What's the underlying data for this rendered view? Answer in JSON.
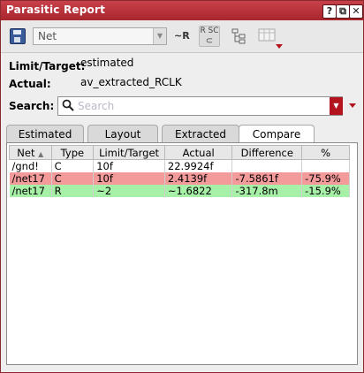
{
  "window": {
    "title": "Parasitic Report",
    "buttons": [
      "?",
      "⧉",
      "✕"
    ]
  },
  "toolbar": {
    "net_select_value": "Net",
    "r_label": "~R",
    "rsc_icon_text": "R SC"
  },
  "info": {
    "limit_label": "Limit/Target:",
    "limit_value": "estimated",
    "actual_label": "Actual:",
    "actual_value": "av_extracted_RCLK"
  },
  "search": {
    "label": "Search:",
    "placeholder": "Search"
  },
  "tabs": [
    {
      "label": "Estimated"
    },
    {
      "label": "Layout"
    },
    {
      "label": "Extracted"
    },
    {
      "label": "Compare"
    }
  ],
  "table": {
    "headers": [
      "Net",
      "Type",
      "Limit/Target",
      "Actual",
      "Difference",
      "%"
    ],
    "rows": [
      {
        "net": "/gnd!",
        "type": "C",
        "limit": "10f",
        "actual": "22.9924f",
        "difference": "",
        "pct": ""
      },
      {
        "net": "/net17",
        "type": "C",
        "limit": "10f",
        "actual": "2.4139f",
        "difference": "-7.5861f",
        "pct": "-75.9%"
      },
      {
        "net": "/net17",
        "type": "R",
        "limit": "~2",
        "actual": "~1.6822",
        "difference": "-317.8m",
        "pct": "-15.9%"
      }
    ]
  },
  "colors": {
    "title_bar": "#b3141e",
    "row_fail": "#f39a9b",
    "row_pass": "#a7f0a8"
  }
}
